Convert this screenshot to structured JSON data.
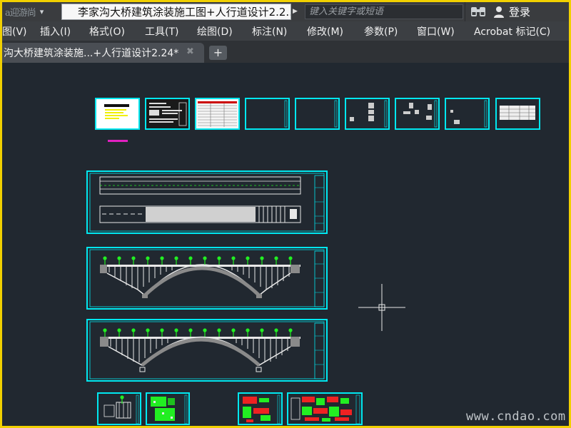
{
  "titlebar": {
    "quick_access_glyph": "▾",
    "ghost_text": "a迎游尚",
    "document_title": "李家沟大桥建筑涂装施工图+人行道设计2.2...",
    "title_dropdown_glyph": "▶",
    "search_placeholder": "键入关键字或短语",
    "login_label": "登录"
  },
  "menubar": {
    "items": [
      "图(V)",
      "插入(I)",
      "格式(O)",
      "工具(T)",
      "绘图(D)",
      "标注(N)",
      "修改(M)",
      "参数(P)",
      "窗口(W)",
      "Acrobat 标记(C)"
    ]
  },
  "tabs": {
    "active_label": "沟大桥建筑涂装施...+人行道设计2.24*",
    "close_glyph": "✖",
    "add_glyph": "+"
  },
  "watermark": "www.cndao.com",
  "colors": {
    "outer_border": "#f1d000",
    "canvas_bg": "#212830",
    "sheet_frame": "#00e8f0",
    "drawing_white": "#e8e8e8",
    "tree_green": "#22ee22",
    "marker_magenta": "#e020c0",
    "yellow_text": "#f0f000",
    "red_hatch": "#ee2222"
  }
}
